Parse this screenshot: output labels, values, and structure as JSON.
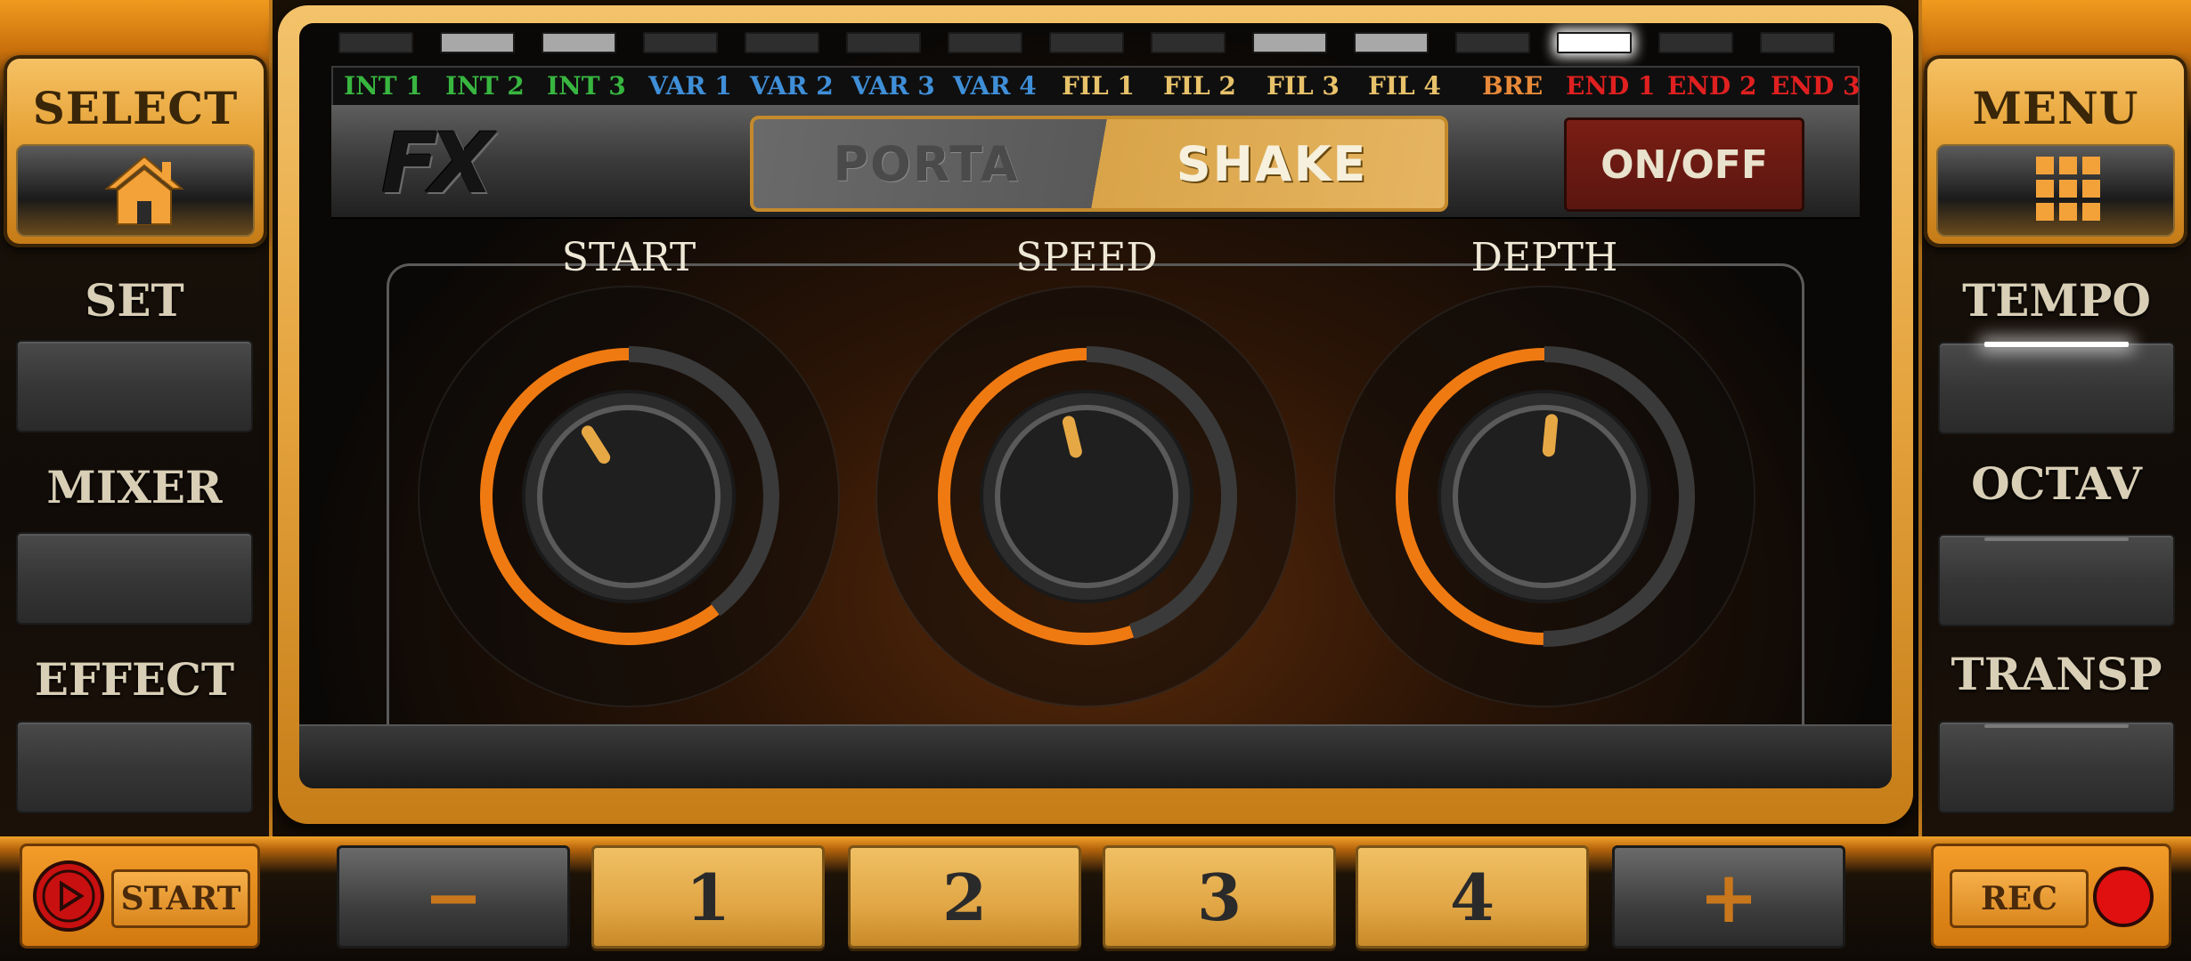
{
  "left_panel": {
    "select_label": "SELECT",
    "set_label": "SET",
    "mixer_label": "MIXER",
    "effect_label": "EFFECT"
  },
  "right_panel": {
    "menu_label": "MENU",
    "tempo_label": "TEMPO",
    "octav_label": "OCTAV",
    "transp_label": "TRANSP"
  },
  "pattern_labels": [
    {
      "text": "INT 1",
      "color": "#38b640"
    },
    {
      "text": "INT 2",
      "color": "#38b640"
    },
    {
      "text": "INT 3",
      "color": "#38b640"
    },
    {
      "text": "VAR 1",
      "color": "#3f8fd8"
    },
    {
      "text": "VAR 2",
      "color": "#3f8fd8"
    },
    {
      "text": "VAR 3",
      "color": "#3f8fd8"
    },
    {
      "text": "VAR 4",
      "color": "#3f8fd8"
    },
    {
      "text": "FIL 1",
      "color": "#e8c26a"
    },
    {
      "text": "FIL 2",
      "color": "#e8c26a"
    },
    {
      "text": "FIL 3",
      "color": "#e8c26a"
    },
    {
      "text": "FIL 4",
      "color": "#e8c26a"
    },
    {
      "text": "BRE",
      "color": "#e88a3a"
    },
    {
      "text": "END 1",
      "color": "#e02020"
    },
    {
      "text": "END 2",
      "color": "#e02020"
    },
    {
      "text": "END 3",
      "color": "#e02020"
    }
  ],
  "fx": {
    "logo": "FX",
    "mode_off": "PORTA",
    "mode_on": "SHAKE",
    "onoff_label": "ON/OFF"
  },
  "knobs": [
    {
      "label": "START",
      "value": 0.38
    },
    {
      "label": "SPEED",
      "value": 0.45
    },
    {
      "label": "DEPTH",
      "value": 0.52
    }
  ],
  "bottom": {
    "start_label": "START",
    "minus_label": "−",
    "buttons": [
      "1",
      "2",
      "3",
      "4"
    ],
    "plus_label": "+",
    "rec_label": "REC"
  },
  "colors": {
    "accent": "#f07a12",
    "gold": "#e6a845",
    "record": "#e01010"
  }
}
